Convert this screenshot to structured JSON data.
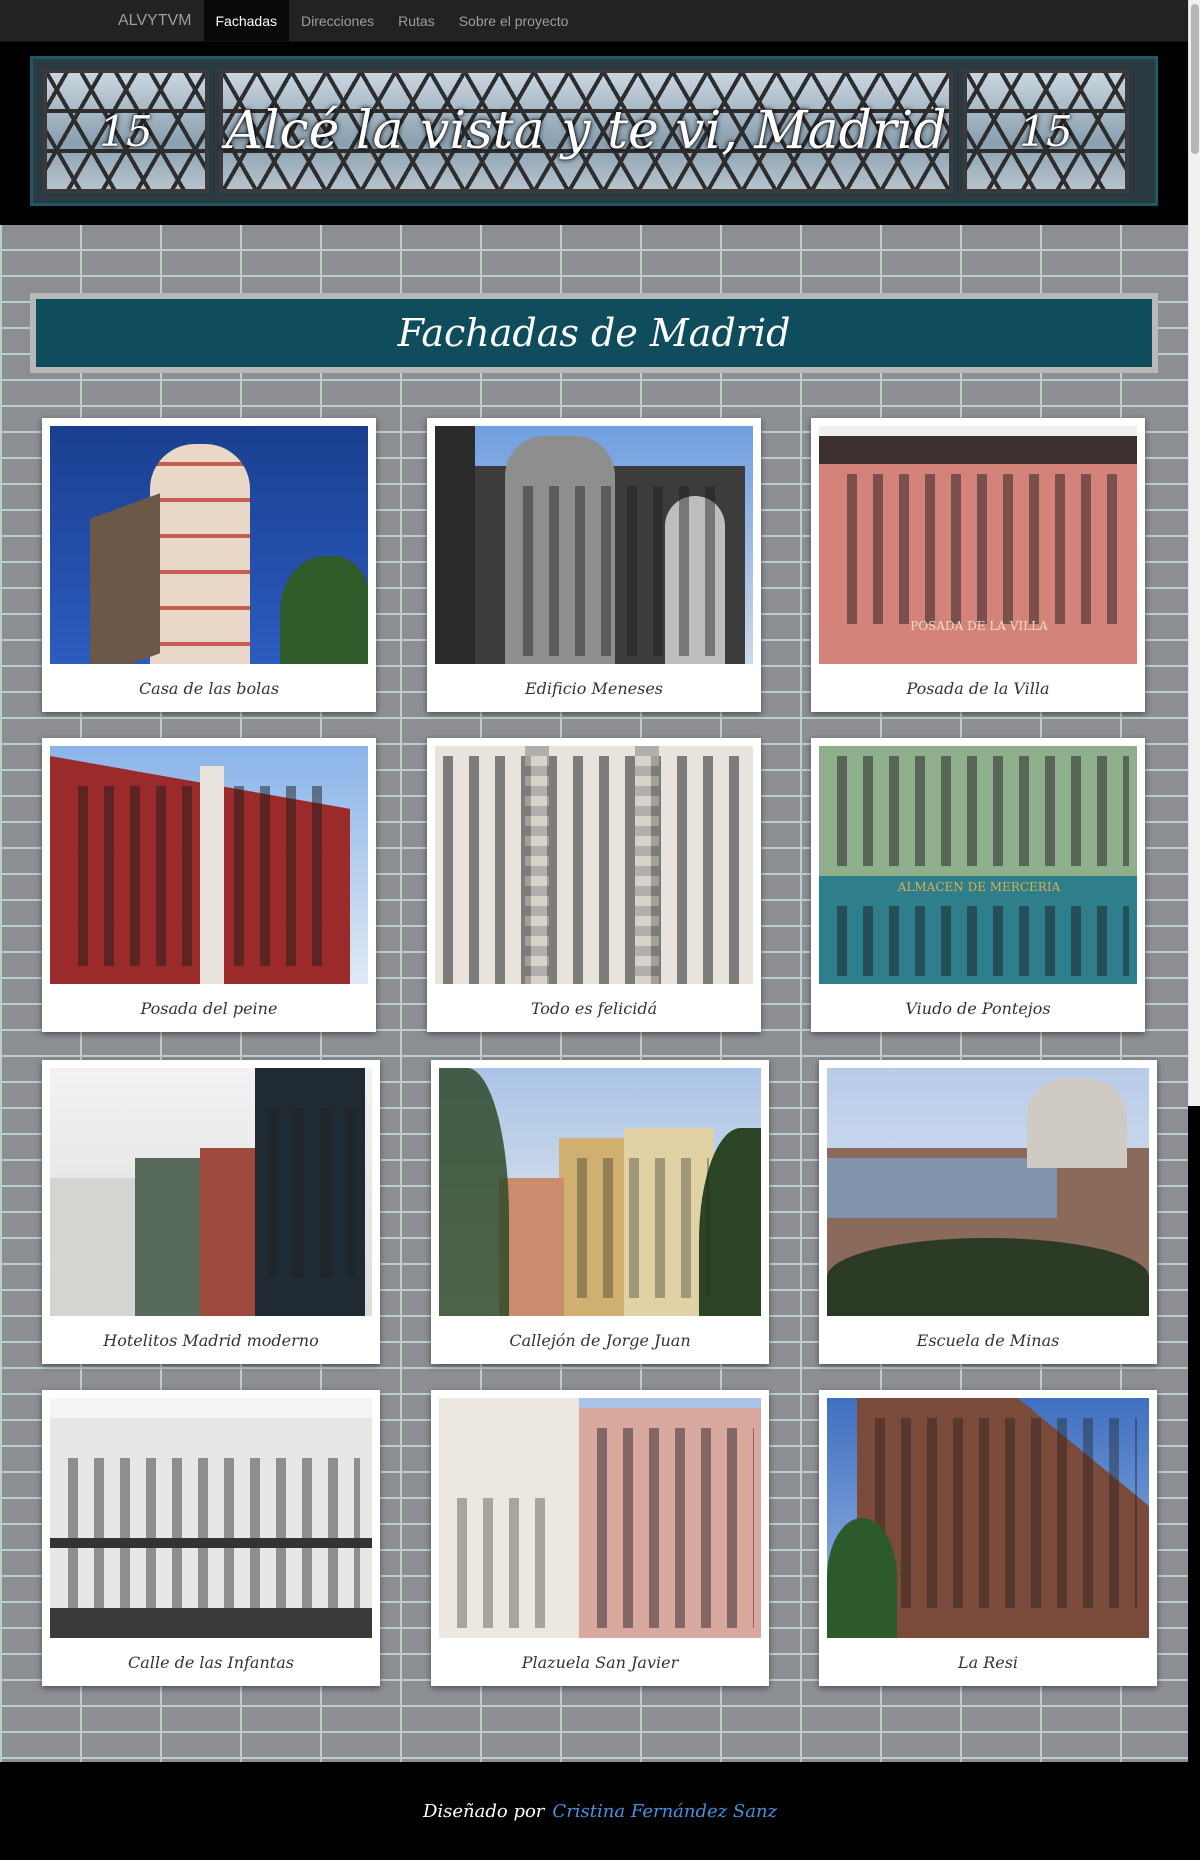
{
  "nav": {
    "brand": "ALVYTVM",
    "items": [
      "Fachadas",
      "Direcciones",
      "Rutas",
      "Sobre el proyecto"
    ],
    "active": "Fachadas"
  },
  "banner": {
    "left": "15",
    "title": "Alcé la vista y te vi, Madrid",
    "right": "15"
  },
  "page": {
    "heading": "Fachadas de Madrid"
  },
  "cards": [
    {
      "caption": "Casa de las bolas"
    },
    {
      "caption": "Edificio Meneses"
    },
    {
      "caption": "Posada de la Villa"
    },
    {
      "caption": "Posada del peine"
    },
    {
      "caption": "Todo es felicidá"
    },
    {
      "caption": "Viudo de Pontejos"
    },
    {
      "caption": "Hotelitos Madrid moderno"
    },
    {
      "caption": "Callejón de Jorge Juan"
    },
    {
      "caption": "Escuela de Minas"
    },
    {
      "caption": "Calle de las Infantas"
    },
    {
      "caption": "Plazuela San Javier"
    },
    {
      "caption": "La Resi"
    }
  ],
  "photo_signs": {
    "posada_villa": "POSADA DE LA VILLA",
    "almacen": "ALMACEN DE MERCERIA"
  },
  "footer": {
    "prefix": "Diseñado por",
    "author": "Cristina Fernández Sanz"
  }
}
